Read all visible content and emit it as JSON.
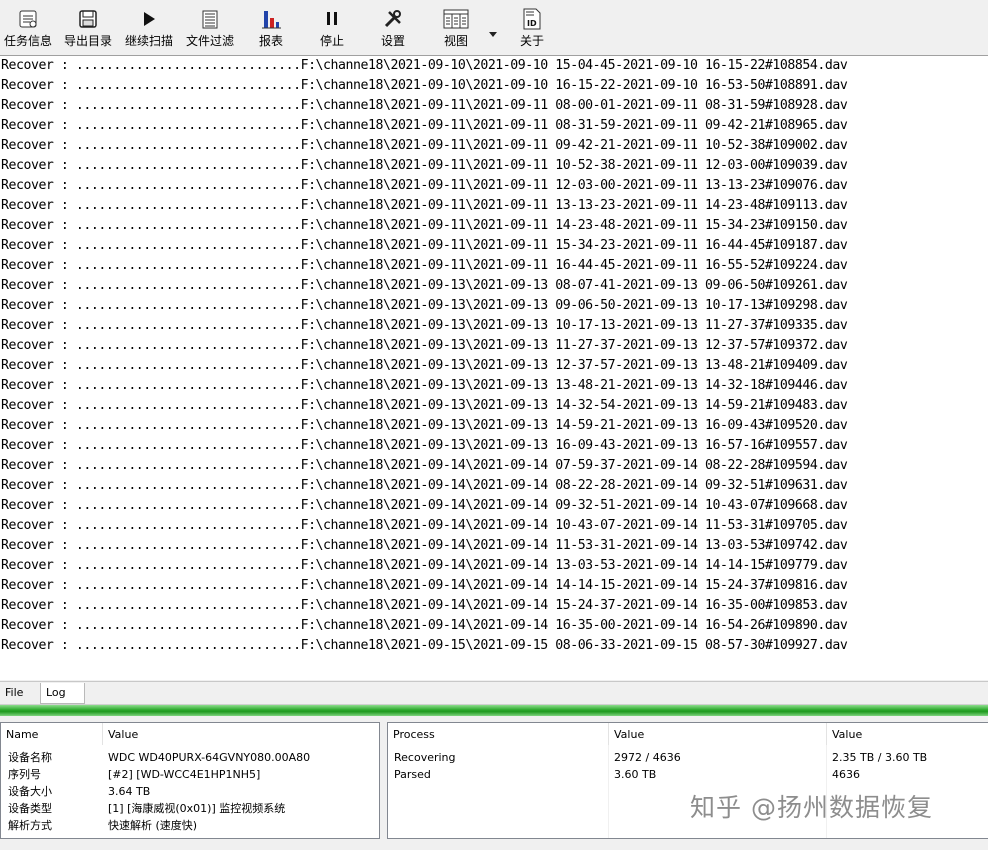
{
  "toolbar": {
    "buttons": [
      {
        "label": "任务信息",
        "icon": "task-info-icon"
      },
      {
        "label": "导出目录",
        "icon": "export-icon"
      },
      {
        "label": "继续扫描",
        "icon": "play-icon"
      },
      {
        "label": "文件过滤",
        "icon": "filter-icon"
      },
      {
        "label": "报表",
        "icon": "report-chart-icon"
      },
      {
        "label": "停止",
        "icon": "pause-icon"
      },
      {
        "label": "设置",
        "icon": "tools-icon"
      },
      {
        "label": "视图",
        "icon": "view-icon"
      },
      {
        "label": "关于",
        "icon": "about-id-icon"
      }
    ]
  },
  "log": {
    "lines": [
      "Recover : ..............................F:\\channe18\\2021-09-10\\2021-09-10 15-04-45-2021-09-10 16-15-22#108854.dav",
      "Recover : ..............................F:\\channe18\\2021-09-10\\2021-09-10 16-15-22-2021-09-10 16-53-50#108891.dav",
      "Recover : ..............................F:\\channe18\\2021-09-11\\2021-09-11 08-00-01-2021-09-11 08-31-59#108928.dav",
      "Recover : ..............................F:\\channe18\\2021-09-11\\2021-09-11 08-31-59-2021-09-11 09-42-21#108965.dav",
      "Recover : ..............................F:\\channe18\\2021-09-11\\2021-09-11 09-42-21-2021-09-11 10-52-38#109002.dav",
      "Recover : ..............................F:\\channe18\\2021-09-11\\2021-09-11 10-52-38-2021-09-11 12-03-00#109039.dav",
      "Recover : ..............................F:\\channe18\\2021-09-11\\2021-09-11 12-03-00-2021-09-11 13-13-23#109076.dav",
      "Recover : ..............................F:\\channe18\\2021-09-11\\2021-09-11 13-13-23-2021-09-11 14-23-48#109113.dav",
      "Recover : ..............................F:\\channe18\\2021-09-11\\2021-09-11 14-23-48-2021-09-11 15-34-23#109150.dav",
      "Recover : ..............................F:\\channe18\\2021-09-11\\2021-09-11 15-34-23-2021-09-11 16-44-45#109187.dav",
      "Recover : ..............................F:\\channe18\\2021-09-11\\2021-09-11 16-44-45-2021-09-11 16-55-52#109224.dav",
      "Recover : ..............................F:\\channe18\\2021-09-13\\2021-09-13 08-07-41-2021-09-13 09-06-50#109261.dav",
      "Recover : ..............................F:\\channe18\\2021-09-13\\2021-09-13 09-06-50-2021-09-13 10-17-13#109298.dav",
      "Recover : ..............................F:\\channe18\\2021-09-13\\2021-09-13 10-17-13-2021-09-13 11-27-37#109335.dav",
      "Recover : ..............................F:\\channe18\\2021-09-13\\2021-09-13 11-27-37-2021-09-13 12-37-57#109372.dav",
      "Recover : ..............................F:\\channe18\\2021-09-13\\2021-09-13 12-37-57-2021-09-13 13-48-21#109409.dav",
      "Recover : ..............................F:\\channe18\\2021-09-13\\2021-09-13 13-48-21-2021-09-13 14-32-18#109446.dav",
      "Recover : ..............................F:\\channe18\\2021-09-13\\2021-09-13 14-32-54-2021-09-13 14-59-21#109483.dav",
      "Recover : ..............................F:\\channe18\\2021-09-13\\2021-09-13 14-59-21-2021-09-13 16-09-43#109520.dav",
      "Recover : ..............................F:\\channe18\\2021-09-13\\2021-09-13 16-09-43-2021-09-13 16-57-16#109557.dav",
      "Recover : ..............................F:\\channe18\\2021-09-14\\2021-09-14 07-59-37-2021-09-14 08-22-28#109594.dav",
      "Recover : ..............................F:\\channe18\\2021-09-14\\2021-09-14 08-22-28-2021-09-14 09-32-51#109631.dav",
      "Recover : ..............................F:\\channe18\\2021-09-14\\2021-09-14 09-32-51-2021-09-14 10-43-07#109668.dav",
      "Recover : ..............................F:\\channe18\\2021-09-14\\2021-09-14 10-43-07-2021-09-14 11-53-31#109705.dav",
      "Recover : ..............................F:\\channe18\\2021-09-14\\2021-09-14 11-53-31-2021-09-14 13-03-53#109742.dav",
      "Recover : ..............................F:\\channe18\\2021-09-14\\2021-09-14 13-03-53-2021-09-14 14-14-15#109779.dav",
      "Recover : ..............................F:\\channe18\\2021-09-14\\2021-09-14 14-14-15-2021-09-14 15-24-37#109816.dav",
      "Recover : ..............................F:\\channe18\\2021-09-14\\2021-09-14 15-24-37-2021-09-14 16-35-00#109853.dav",
      "Recover : ..............................F:\\channe18\\2021-09-14\\2021-09-14 16-35-00-2021-09-14 16-54-26#109890.dav",
      "Recover : ..............................F:\\channe18\\2021-09-15\\2021-09-15 08-06-33-2021-09-15 08-57-30#109927.dav"
    ]
  },
  "tabs": [
    {
      "label": "File"
    },
    {
      "label": "Log"
    }
  ],
  "progress": {
    "fraction": 1.0,
    "color": "#2ba82b"
  },
  "device_panel": {
    "headers": [
      "Name",
      "Value"
    ],
    "rows": [
      {
        "name": "设备名称",
        "value": "WDC WD40PURX-64GVNY080.00A80"
      },
      {
        "name": "序列号",
        "value": "[#2] [WD-WCC4E1HP1NH5]"
      },
      {
        "name": "设备大小",
        "value": "3.64 TB"
      },
      {
        "name": "设备类型",
        "value": "[1] [海康威视(0x01)] 监控视频系统"
      },
      {
        "name": "解析方式",
        "value": "快速解析 (速度快)"
      }
    ]
  },
  "process_panel": {
    "headers": [
      "Process",
      "Value",
      "Value"
    ],
    "rows": [
      {
        "process": "Recovering",
        "value1": "2972 / 4636",
        "value2": "2.35 TB / 3.60 TB"
      },
      {
        "process": "Parsed",
        "value1": "3.60 TB",
        "value2": "4636"
      }
    ]
  },
  "watermark": "知乎 @扬州数据恢复"
}
